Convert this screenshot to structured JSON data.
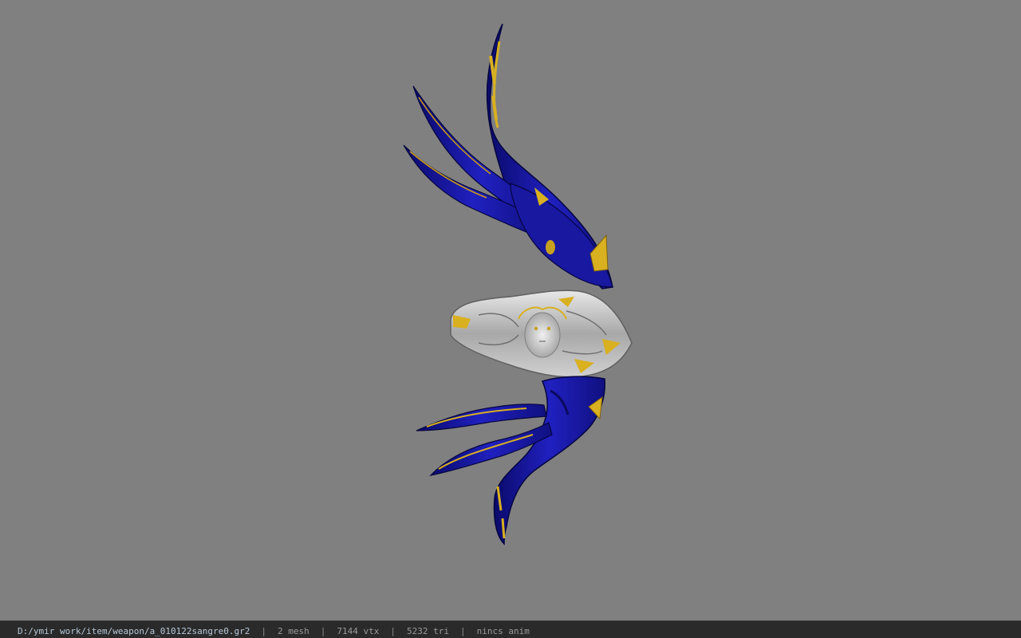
{
  "statusbar": {
    "file_path": "D:/ymir work/item/weapon/a_010122sangre0.gr2",
    "sep": "|",
    "mesh": "2 mesh",
    "vtx": "7144 vtx",
    "tri": "5232 tri",
    "anim": "nincs anim"
  },
  "colors": {
    "background": "#808080",
    "blade_blue": "#1c1ca8",
    "gold": "#d8b020",
    "silver": "#c8c8c8"
  }
}
